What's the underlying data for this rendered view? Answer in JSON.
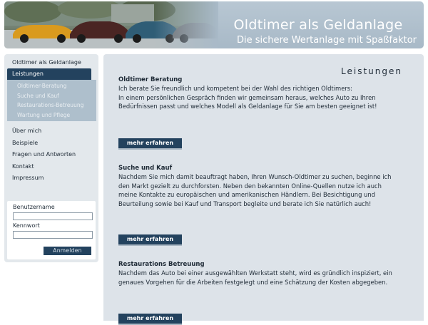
{
  "header": {
    "title": "Oldtimer als Geldanlage",
    "subtitle": "Die sichere Wertanlage mit Spaßfaktor"
  },
  "colors": {
    "accent": "#23425e",
    "panel": "#dde3e9",
    "sidebar": "#e3e8ec",
    "submenu": "#aebfcc",
    "header": "#a8b9c7"
  },
  "sidebar": {
    "items": [
      {
        "label": "Oldtimer als Geldanlage"
      },
      {
        "label": "Leistungen"
      }
    ],
    "subitems": [
      {
        "label": "Oldtimer-Beratung"
      },
      {
        "label": "Suche und Kauf"
      },
      {
        "label": "Restaurations-Betreuung"
      },
      {
        "label": "Wartung und Pflege"
      }
    ],
    "more_items": [
      {
        "label": "Über mich"
      },
      {
        "label": "Beispiele"
      },
      {
        "label": "Fragen und Antworten"
      },
      {
        "label": "Kontakt"
      },
      {
        "label": "Impressum"
      }
    ]
  },
  "login": {
    "username_label": "Benutzername",
    "username_value": "",
    "password_label": "Kennwort",
    "password_value": "",
    "submit_label": "Anmelden"
  },
  "main": {
    "title": "Leistungen",
    "sections": [
      {
        "title": "Oldtimer Beratung",
        "lines": [
          "Ich berate Sie freundlich und kompetent bei der Wahl des richtigen Oldtimers:",
          "In einem persönlichen Gespräch finden wir gemeinsam heraus, welches Auto zu Ihren",
          "Bedürfnissen passt und welches Modell als Geldanlage für Sie am besten geeignet ist!"
        ],
        "button": "mehr erfahren"
      },
      {
        "title": "Suche und Kauf",
        "lines": [
          "Nachdem Sie mich damit beauftragt haben, Ihren Wunsch-Oldtimer zu suchen, beginne ich",
          "den Markt gezielt zu durchforsten. Neben den bekannten Online-Quellen nutze ich auch",
          "meine Kontakte zu europäischen und amerikanischen Händlern. Bei Besichtigung und",
          "Beurteilung sowie bei Kauf und Transport begleite und berate ich Sie natürlich auch!"
        ],
        "button": "mehr erfahren"
      },
      {
        "title": "Restaurations Betreuung",
        "lines": [
          "Nachdem das Auto bei einer ausgewählten Werkstatt steht, wird es gründlich inspiziert, ein",
          "genaues Vorgehen für die Arbeiten festgelegt und eine Schätzung der Kosten abgegeben."
        ],
        "button": "mehr erfahren"
      }
    ]
  }
}
